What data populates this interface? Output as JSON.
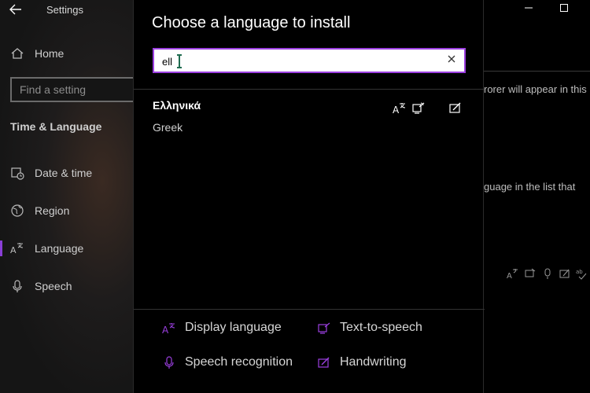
{
  "window": {
    "title": "Settings"
  },
  "sidebar": {
    "home_label": "Home",
    "search_placeholder": "Find a setting",
    "section_heading": "Time & Language",
    "items": [
      {
        "label": "Date & time",
        "icon": "clock-calendar-icon"
      },
      {
        "label": "Region",
        "icon": "globe-icon"
      },
      {
        "label": "Language",
        "icon": "language-icon"
      },
      {
        "label": "Speech",
        "icon": "microphone-icon"
      }
    ],
    "active_item": "Language"
  },
  "background": {
    "text_line_1": "rorer will appear in this",
    "text_line_2": "guage in the list that"
  },
  "dialog": {
    "title": "Choose a language to install",
    "search_value": "ell",
    "results": [
      {
        "native_name": "Ελληνικά",
        "english_name": "Greek"
      }
    ],
    "legend": {
      "display_language": "Display language",
      "text_to_speech": "Text-to-speech",
      "speech_recognition": "Speech recognition",
      "handwriting": "Handwriting"
    }
  },
  "colors": {
    "accent": "#9b3fe0",
    "background": "#000000"
  }
}
